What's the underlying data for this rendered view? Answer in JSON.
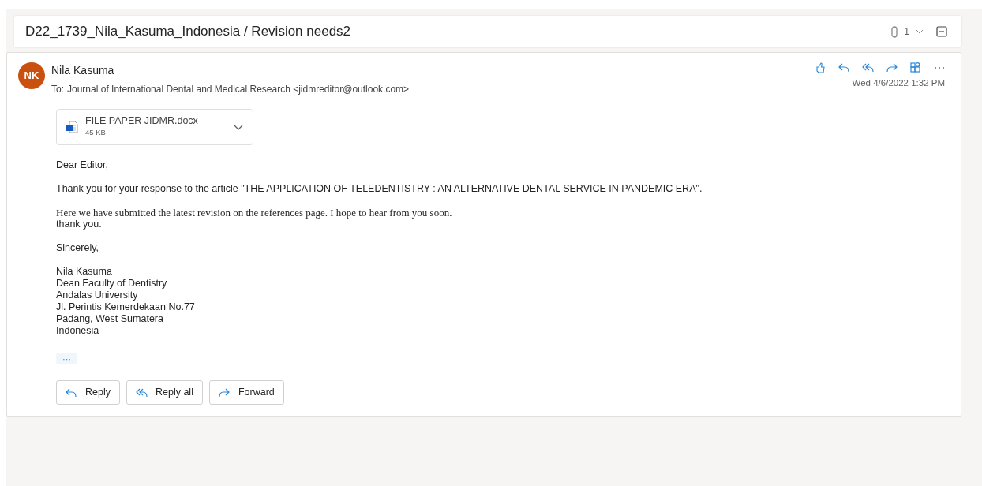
{
  "conversation": {
    "subject": "D22_1739_Nila_Kasuma_Indonesia / Revision needs2",
    "attachment_count": "1"
  },
  "message": {
    "avatar_initials": "NK",
    "sender": "Nila Kasuma",
    "to_label": "To:",
    "recipient": "Journal of International Dental and Medical Research <jidmreditor@outlook.com>",
    "date": "Wed 4/6/2022 1:32 PM",
    "attachment": {
      "name": "FILE PAPER JIDMR.docx",
      "size": "45 KB"
    },
    "paragraphs": [
      {
        "kind": "sans",
        "lines": [
          "Dear Editor,"
        ]
      },
      {
        "kind": "sans",
        "lines": [
          "Thank you for your response to the article \"THE APPLICATION OF TELEDENTISTRY : AN ALTERNATIVE DENTAL SERVICE IN PANDEMIC ERA\"."
        ]
      },
      {
        "kind": "serif",
        "lines": [
          "Here we have submitted the latest revision on the references page. I hope to hear from you soon."
        ],
        "then": "thank you."
      },
      {
        "kind": "sans",
        "lines": [
          "Sincerely,"
        ]
      },
      {
        "kind": "sans",
        "lines": [
          "Nila Kasuma",
          "Dean Faculty of Dentistry",
          "Andalas University",
          "Jl. Perintis Kemerdekaan No.77",
          "Padang, West Sumatera",
          "Indonesia"
        ]
      }
    ],
    "expand_label": "···",
    "buttons": [
      {
        "kind": "reply",
        "label": "Reply"
      },
      {
        "kind": "reply-all",
        "label": "Reply all"
      },
      {
        "kind": "forward",
        "label": "Forward"
      }
    ]
  }
}
